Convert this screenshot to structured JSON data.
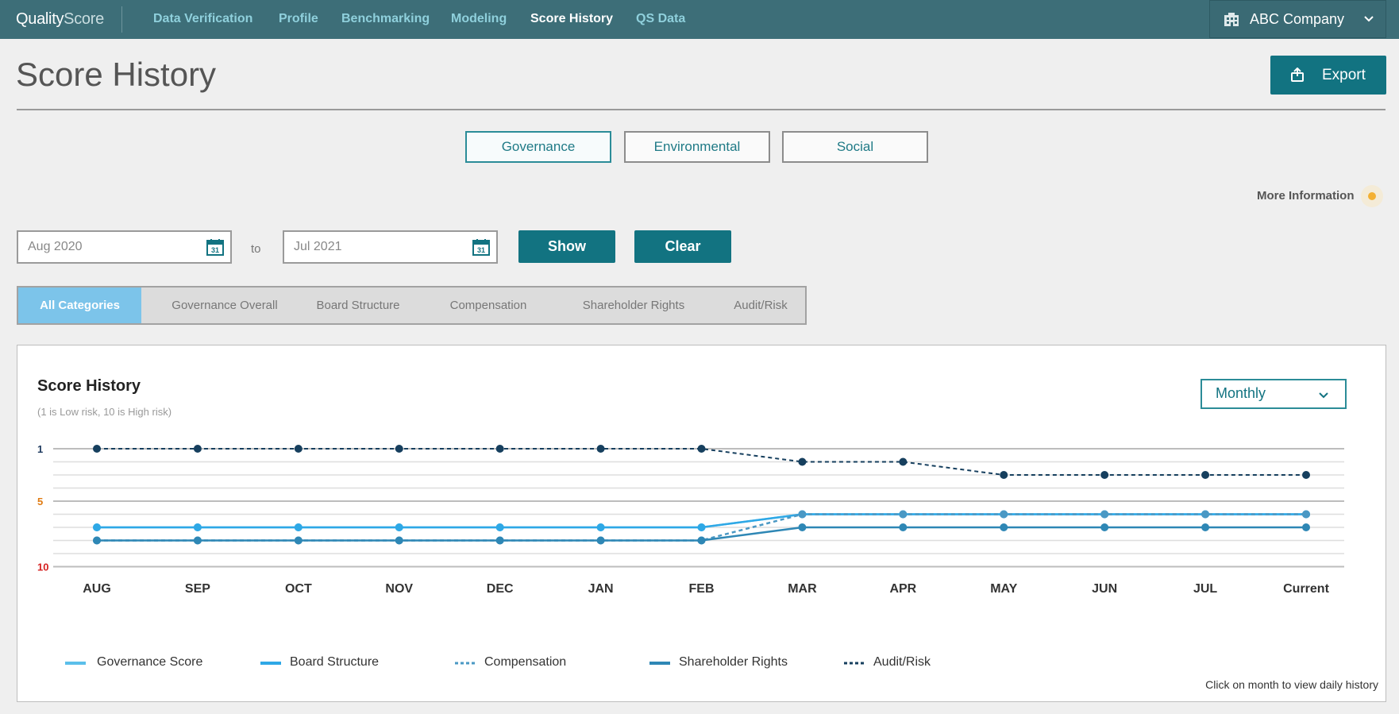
{
  "nav": {
    "logo_quality": "Quality",
    "logo_score": "Score",
    "links": [
      "Data Verification",
      "Profile",
      "Benchmarking",
      "Modeling",
      "Score History",
      "QS Data"
    ],
    "active": "Score History",
    "company": "ABC Company"
  },
  "header": {
    "title": "Score History",
    "export_label": "Export"
  },
  "domains": {
    "tabs": [
      "Governance",
      "Environmental",
      "Social"
    ],
    "active": "Governance"
  },
  "more_info": "More Information",
  "date_range": {
    "from": "Aug 2020",
    "to_label": "to",
    "to": "Jul 2021",
    "calendar_day": "31"
  },
  "buttons": {
    "show": "Show",
    "clear": "Clear"
  },
  "categories": {
    "tabs": [
      "All Categories",
      "Governance Overall",
      "Board Structure",
      "Compensation",
      "Shareholder Rights",
      "Audit/Risk"
    ],
    "active": "All Categories"
  },
  "chart_card": {
    "title": "Score History",
    "subtitle": "(1 is Low risk, 10 is High risk)",
    "period": "Monthly",
    "hint": "Click on month to view daily history"
  },
  "colors": {
    "nav_bg": "#3d6e78",
    "accent": "#127381",
    "governance": "#5bbfea",
    "board": "#2ea8e6",
    "compensation": "#4a98c4",
    "shareholder": "#2e87b5",
    "audit": "#163f5e",
    "tick_low": "#1e3a5f",
    "tick_mid": "#e07b12",
    "tick_high": "#d62222"
  },
  "chart_data": {
    "type": "line",
    "x": [
      "AUG",
      "SEP",
      "OCT",
      "NOV",
      "DEC",
      "JAN",
      "FEB",
      "MAR",
      "APR",
      "MAY",
      "JUN",
      "JUL",
      "Current"
    ],
    "ylim": [
      1,
      10
    ],
    "y_inverted": true,
    "yticks": [
      1,
      5,
      10
    ],
    "series": [
      {
        "name": "Governance Score",
        "style": "solid",
        "values": [
          7,
          7,
          7,
          7,
          7,
          7,
          7,
          6,
          6,
          6,
          6,
          6,
          6
        ]
      },
      {
        "name": "Board Structure",
        "style": "solid",
        "values": [
          7,
          7,
          7,
          7,
          7,
          7,
          7,
          6,
          6,
          6,
          6,
          6,
          6
        ]
      },
      {
        "name": "Compensation",
        "style": "dashed",
        "values": [
          8,
          8,
          8,
          8,
          8,
          8,
          8,
          6,
          6,
          6,
          6,
          6,
          6
        ]
      },
      {
        "name": "Shareholder Rights",
        "style": "solid",
        "values": [
          8,
          8,
          8,
          8,
          8,
          8,
          8,
          7,
          7,
          7,
          7,
          7,
          7
        ]
      },
      {
        "name": "Audit/Risk",
        "style": "dashed",
        "values": [
          1,
          1,
          1,
          1,
          1,
          1,
          1,
          2,
          2,
          3,
          3,
          3,
          3
        ]
      }
    ]
  }
}
